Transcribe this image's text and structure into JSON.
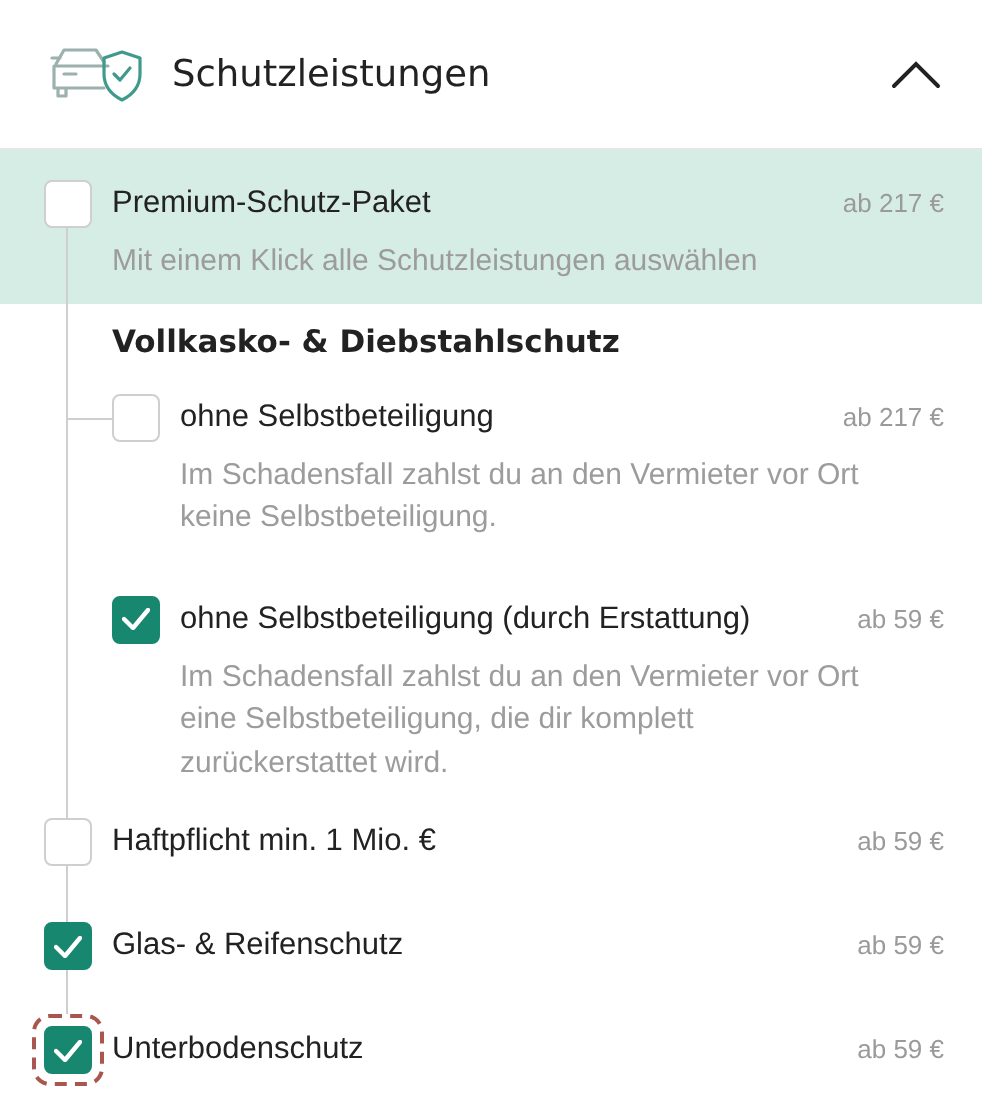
{
  "header": {
    "title": "Schutzleistungen",
    "expanded": true
  },
  "package": {
    "label": "Premium-Schutz-Paket",
    "price": "ab 217 €",
    "description": "Mit einem Klick alle Schutzleistungen auswählen",
    "checked": false
  },
  "items": [
    {
      "kind": "group",
      "title": "Vollkasko- & Diebstahlschutz",
      "children": [
        {
          "label": "ohne Selbstbeteiligung",
          "price": "ab 217 €",
          "description": "Im Schadensfall zahlst du an den Vermieter vor Ort keine Selbstbeteiligung.",
          "checked": false,
          "focused": false
        },
        {
          "label": "ohne Selbstbeteiligung (durch Erstattung)",
          "price": "ab 59 €",
          "description": "Im Schadensfall zahlst du an den Vermieter vor Ort eine Selbstbeteiligung, die dir komplett zurückerstattet wird.",
          "checked": true,
          "focused": false
        }
      ]
    },
    {
      "kind": "option",
      "label": "Haftpflicht min. 1 Mio. €",
      "price": "ab 59 €",
      "checked": false,
      "focused": false
    },
    {
      "kind": "option",
      "label": "Glas- & Reifenschutz",
      "price": "ab 59 €",
      "checked": true,
      "focused": false
    },
    {
      "kind": "option",
      "label": "Unterbodenschutz",
      "price": "ab 59 €",
      "checked": true,
      "focused": true
    }
  ]
}
